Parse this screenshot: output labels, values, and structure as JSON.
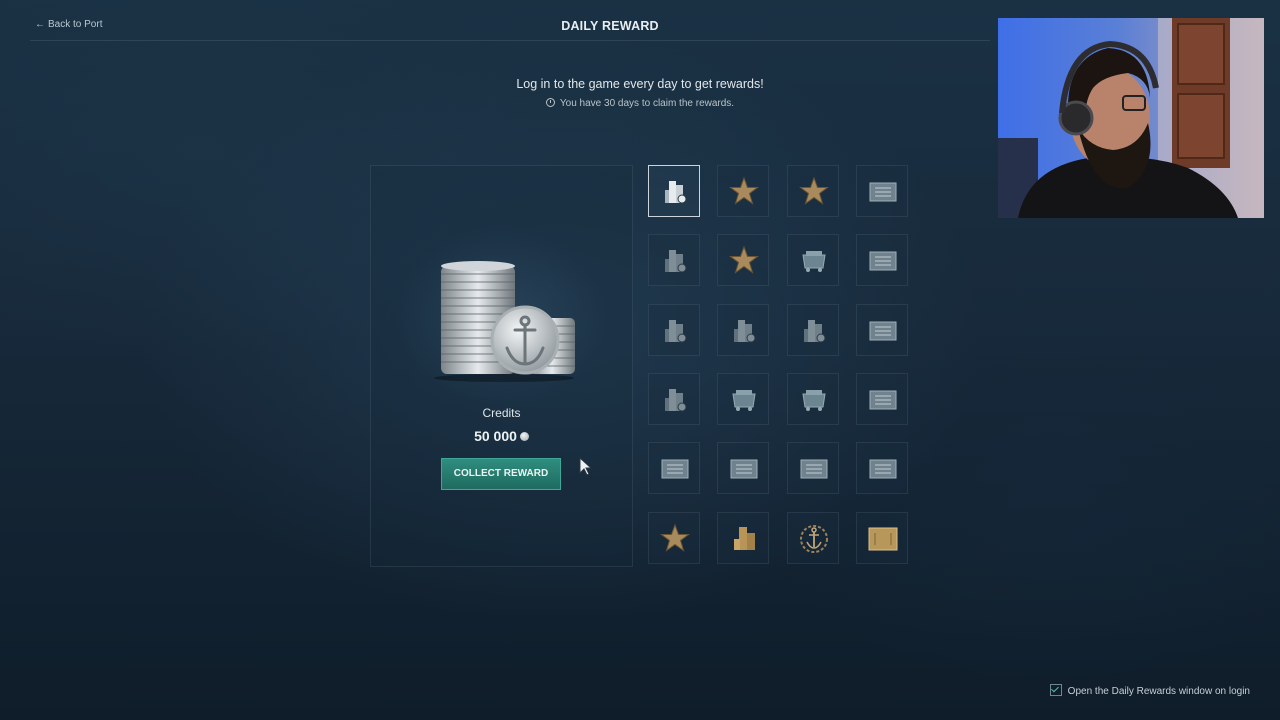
{
  "header": {
    "back_label": "Back to Port",
    "title": "DAILY REWARD"
  },
  "intro": {
    "headline": "Log in to the game every day to get rewards!",
    "deadline": "You have 30 days to claim the rewards."
  },
  "selected_reward": {
    "name": "Credits",
    "amount": "50 000",
    "collect_label": "COLLECT REWARD",
    "icon": "credits-stack-icon"
  },
  "reward_grid": {
    "columns": 4,
    "rows": 6,
    "current_day": 1,
    "items": [
      {
        "day": 1,
        "icon": "credits"
      },
      {
        "day": 2,
        "icon": "star"
      },
      {
        "day": 3,
        "icon": "star"
      },
      {
        "day": 4,
        "icon": "ticket"
      },
      {
        "day": 5,
        "icon": "credits"
      },
      {
        "day": 6,
        "icon": "star"
      },
      {
        "day": 7,
        "icon": "container"
      },
      {
        "day": 8,
        "icon": "ticket"
      },
      {
        "day": 9,
        "icon": "credits"
      },
      {
        "day": 10,
        "icon": "credits"
      },
      {
        "day": 11,
        "icon": "credits"
      },
      {
        "day": 12,
        "icon": "ticket"
      },
      {
        "day": 13,
        "icon": "credits"
      },
      {
        "day": 14,
        "icon": "container"
      },
      {
        "day": 15,
        "icon": "container"
      },
      {
        "day": 16,
        "icon": "ticket"
      },
      {
        "day": 17,
        "icon": "ticket"
      },
      {
        "day": 18,
        "icon": "ticket"
      },
      {
        "day": 19,
        "icon": "ticket"
      },
      {
        "day": 20,
        "icon": "ticket"
      },
      {
        "day": 21,
        "icon": "star"
      },
      {
        "day": 22,
        "icon": "gold-stack"
      },
      {
        "day": 23,
        "icon": "anchor-emblem"
      },
      {
        "day": 24,
        "icon": "gold-ticket"
      }
    ]
  },
  "footer": {
    "auto_open_label": "Open the Daily Rewards window on login",
    "auto_open_checked": true
  },
  "colors": {
    "accent_teal": "#2f8d7f",
    "star_gold": "#b8925a",
    "silver": "#c9cfd3"
  }
}
